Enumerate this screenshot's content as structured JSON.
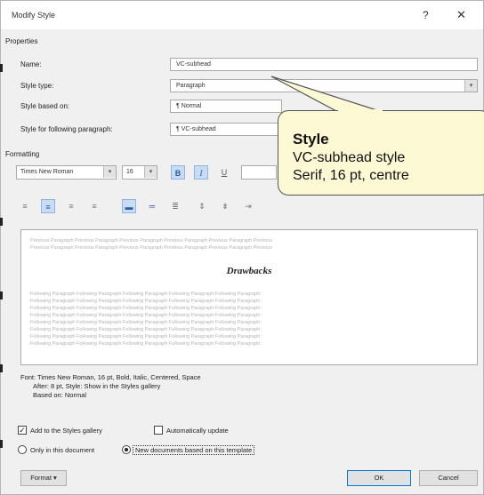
{
  "dialog": {
    "title": "Modify Style",
    "help_icon": "question-mark-icon",
    "close_icon": "close-icon"
  },
  "properties": {
    "section_label": "Properties",
    "name_label": "Name:",
    "name_value": "VC-subhead",
    "style_type_label": "Style type:",
    "style_type_value": "Paragraph",
    "based_on_label": "Style based on:",
    "based_on_value": "¶ Normal",
    "following_label": "Style for following paragraph:",
    "following_value": "¶ VC-subhead"
  },
  "formatting": {
    "section_label": "Formatting",
    "font_name": "Times New Roman",
    "font_size": "16",
    "bold_label": "B",
    "italic_label": "I",
    "underline_label": "U"
  },
  "preview": {
    "preview_text": "Drawbacks",
    "prev_para": "Previous Paragraph Previous Paragraph Previous Paragraph Previous Paragraph Previous Paragraph Previous",
    "follow_para": "Following Paragraph Following Paragraph Following Paragraph Following Paragraph Following Paragraph"
  },
  "description": {
    "line1": "Font: Times New Roman, 16 pt, Bold, Italic, Centered, Space",
    "line2": "After:  8 pt, Style: Show in the Styles gallery",
    "line3": "Based on: Normal"
  },
  "options": {
    "add_to_gallery_label": "Add to the Styles gallery",
    "add_to_gallery_checked": true,
    "auto_update_label": "Automatically update",
    "auto_update_checked": false,
    "only_this_doc_label": "Only in this document",
    "new_docs_label": "New documents based on this template"
  },
  "buttons": {
    "format_label": "Format ▾",
    "ok_label": "OK",
    "cancel_label": "Cancel"
  },
  "callout": {
    "title": "Style",
    "line1": "VC-subhead style",
    "line2": "Serif, 16 pt, centre"
  },
  "colors": {
    "dialog_bg": "#f0f0f0",
    "callout_fill": "#fdf9d4",
    "toggle_active": "#c8dcf3",
    "accent_blue": "#2a5aa8"
  }
}
